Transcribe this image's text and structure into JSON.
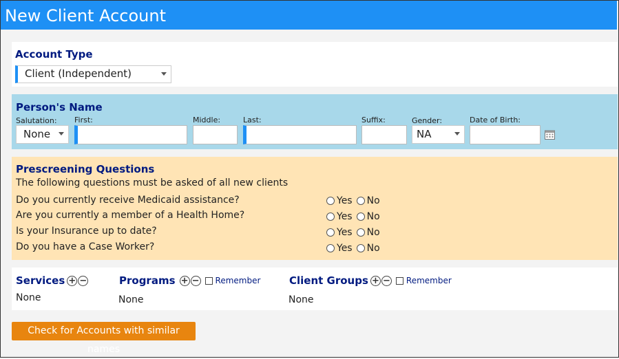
{
  "title": "New Client Account",
  "account_type": {
    "heading": "Account Type",
    "value": "Client (Independent)"
  },
  "person_name": {
    "heading": "Person's Name",
    "salutation_label": "Salutation:",
    "salutation_value": "None",
    "first_label": "First:",
    "middle_label": "Middle:",
    "last_label": "Last:",
    "suffix_label": "Suffix:",
    "gender_label": "Gender:",
    "gender_value": "NA",
    "dob_label": "Date of Birth:"
  },
  "prescreening": {
    "heading": "Prescreening Questions",
    "intro": "The following questions must be asked of all new clients",
    "yes_label": "Yes",
    "no_label": "No",
    "questions": [
      "Do you currently receive Medicaid assistance?",
      "Are you currently a member of a Health Home?",
      "Is your Insurance up to date?",
      "Do you have a Case Worker?"
    ]
  },
  "services": {
    "heading": "Services",
    "value": "None"
  },
  "programs": {
    "heading": "Programs",
    "remember_label": "Remember",
    "value": "None"
  },
  "client_groups": {
    "heading": "Client Groups",
    "remember_label": "Remember",
    "value": "None"
  },
  "check_button_label": "Check for Accounts with similar names",
  "icons": {
    "add": "+",
    "remove": "−"
  },
  "colors": {
    "titlebar": "#1e90f5",
    "name_panel": "#a8d8ea",
    "prescreen_panel": "#ffe4b5",
    "button": "#e8850f",
    "heading": "#001a80"
  }
}
